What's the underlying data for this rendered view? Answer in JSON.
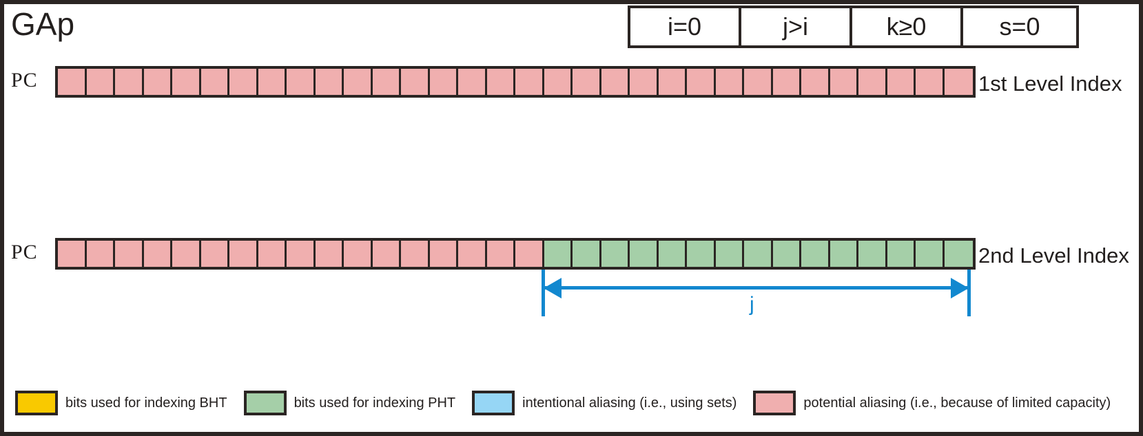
{
  "diagram": {
    "title": "GAp",
    "conditions": [
      {
        "label": "i=0"
      },
      {
        "label": "j>i"
      },
      {
        "label": "k≥0"
      },
      {
        "label": "s=0"
      }
    ],
    "rows": [
      {
        "source_label": "PC",
        "index_label": "1st Level Index",
        "total_bits": 32,
        "segments": [
          {
            "color_key": "pink",
            "count": 32
          }
        ]
      },
      {
        "source_label": "PC",
        "index_label": "2nd Level Index",
        "total_bits": 32,
        "segments": [
          {
            "color_key": "pink",
            "count": 17
          },
          {
            "color_key": "green",
            "count": 15
          }
        ]
      }
    ],
    "measurement": {
      "label": "j",
      "spans_bits": 15,
      "color": "#1288cf"
    },
    "legend": [
      {
        "color_key": "yellow",
        "text": "bits used for indexing BHT"
      },
      {
        "color_key": "green",
        "text": "bits used for indexing PHT"
      },
      {
        "color_key": "blue",
        "text": "intentional aliasing (i.e., using sets)"
      },
      {
        "color_key": "pink",
        "text": "potential aliasing (i.e., because of limited capacity)"
      }
    ],
    "colors": {
      "pink": "#f0afaf",
      "green": "#a5cfa8",
      "yellow": "#f9c900",
      "blue": "#96d6f5",
      "outline": "#2b2523",
      "text": "#231f1e",
      "accent": "#1288cf"
    }
  }
}
